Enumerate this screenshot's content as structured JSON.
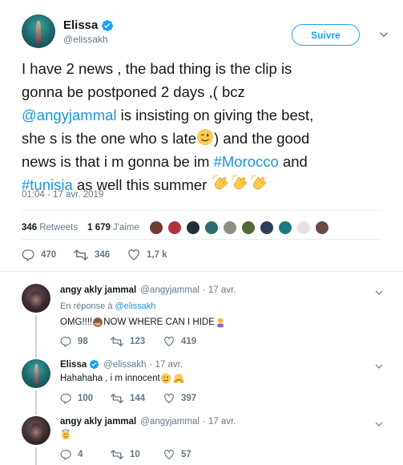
{
  "main_tweet": {
    "author_name": "Elissa",
    "author_handle": "@elissakh",
    "follow_label": "Suivre",
    "text_lines": [
      "I have 2 news , the bad thing is the clip is",
      "gonna be postponed 2 days ,( bcz",
      " is insisting on giving the best,",
      "she s  is the one who s late",
      ") and the good",
      "news is that i m gonna be im ",
      " and",
      " as well this summer "
    ],
    "mention": "@angyjammal",
    "hashtag_morocco": "#Morocco",
    "hashtag_tunisia": "#tunisia",
    "timestamp": "01:04 - 17 avr. 2019",
    "retweets_count": "346",
    "retweets_label": "Retweets",
    "likes_count": "1 679",
    "likes_label": "J'aime",
    "actions": {
      "replies": "470",
      "retweets": "346",
      "likes": "1,7 k"
    }
  },
  "replies": [
    {
      "author_name": "angy akly jammal",
      "author_handle": "@angyjammal",
      "time": "· 17 avr.",
      "reply_to_label": "En réponse à",
      "reply_to_handle": "@elissakh",
      "text": "OMG!!!! ",
      "text_after": " NOW WHERE CAN I HIDE",
      "actions": {
        "replies": "98",
        "retweets": "123",
        "likes": "419"
      }
    },
    {
      "author_name": "Elissa",
      "author_handle": "@elissakh",
      "time": "· 17 avr.",
      "text": "Hahahaha , i m innocent ",
      "actions": {
        "replies": "100",
        "retweets": "144",
        "likes": "397"
      }
    },
    {
      "author_name": "angy akly jammal",
      "author_handle": "@angyjammal",
      "time": "· 17 avr.",
      "actions": {
        "replies": "4",
        "retweets": "10",
        "likes": "57"
      }
    }
  ],
  "colors": {
    "link": "#1b95e0",
    "follow_border": "#1da1f2",
    "muted": "#657786",
    "verified": "#1da1f2",
    "divider": "#e6ecf0"
  },
  "icons": {
    "reply": "reply-icon",
    "retweet": "retweet-icon",
    "like": "heart-icon",
    "verified": "verified-badge-icon",
    "more": "chevron-down-icon"
  }
}
